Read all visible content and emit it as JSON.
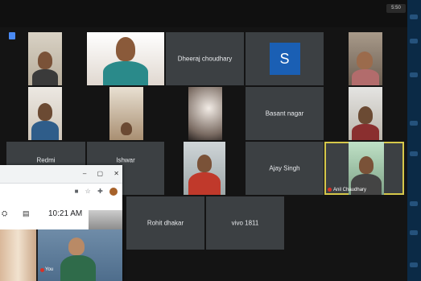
{
  "status": {
    "time_chip": "5:50"
  },
  "grid": {
    "tiles": [
      {
        "label": "",
        "kind": "video"
      },
      {
        "label": "",
        "kind": "video"
      },
      {
        "label": "Dheeraj choudhary",
        "kind": "name"
      },
      {
        "label": "S",
        "kind": "avatar"
      },
      {
        "label": "",
        "kind": "video"
      },
      {
        "label": "",
        "kind": "video"
      },
      {
        "label": "",
        "kind": "video"
      },
      {
        "label": "",
        "kind": "video"
      },
      {
        "label": "Basant nagar",
        "kind": "name"
      },
      {
        "label": "",
        "kind": "video"
      },
      {
        "label": "Redmi",
        "kind": "name"
      },
      {
        "label": "Ishwar",
        "kind": "name"
      },
      {
        "label": "",
        "kind": "video"
      },
      {
        "label": "Ajay Singh",
        "kind": "name"
      },
      {
        "label": "Anil Chaudhary",
        "kind": "video-active"
      },
      {
        "label": "Rohit dhakar",
        "kind": "name"
      },
      {
        "label": "vivo 1811",
        "kind": "name"
      }
    ]
  },
  "browser": {
    "controls": [
      "–",
      "▢",
      "✕"
    ],
    "toolbar_icons": [
      "camera-icon",
      "star-icon",
      "extension-icon"
    ],
    "clock": "10:21 AM",
    "self_label": "You"
  }
}
